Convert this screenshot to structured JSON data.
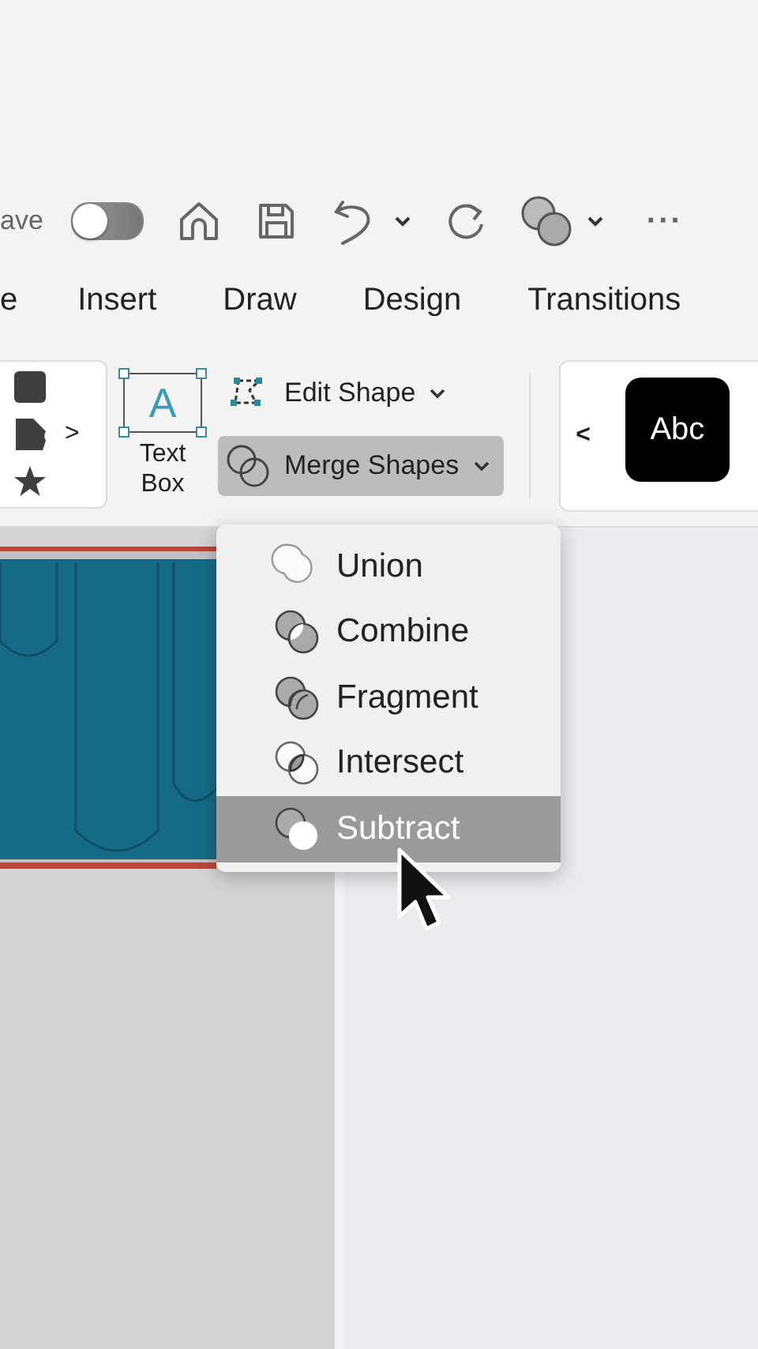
{
  "quick_access": {
    "autosave_label": "ave",
    "autosave_on": false,
    "more": "···"
  },
  "tabs": [
    {
      "label": "e",
      "selected": false
    },
    {
      "label": "Insert",
      "selected": false
    },
    {
      "label": "Draw",
      "selected": false
    },
    {
      "label": "Design",
      "selected": false
    },
    {
      "label": "Transitions",
      "selected": false
    }
  ],
  "ribbon": {
    "shapes_more": ">",
    "text_box": {
      "glyph": "A",
      "label": "Text Box"
    },
    "edit_shape": "Edit Shape",
    "merge_shapes": {
      "label": "Merge Shapes",
      "expanded": true
    },
    "styles": {
      "prev": "<",
      "sample": "Abc"
    }
  },
  "merge_menu": [
    {
      "label": "Union",
      "kind": "union",
      "selected": false
    },
    {
      "label": "Combine",
      "kind": "combine",
      "selected": false
    },
    {
      "label": "Fragment",
      "kind": "fragment",
      "selected": false
    },
    {
      "label": "Intersect",
      "kind": "intersect",
      "selected": false
    },
    {
      "label": "Subtract",
      "kind": "subtract",
      "selected": true
    }
  ]
}
